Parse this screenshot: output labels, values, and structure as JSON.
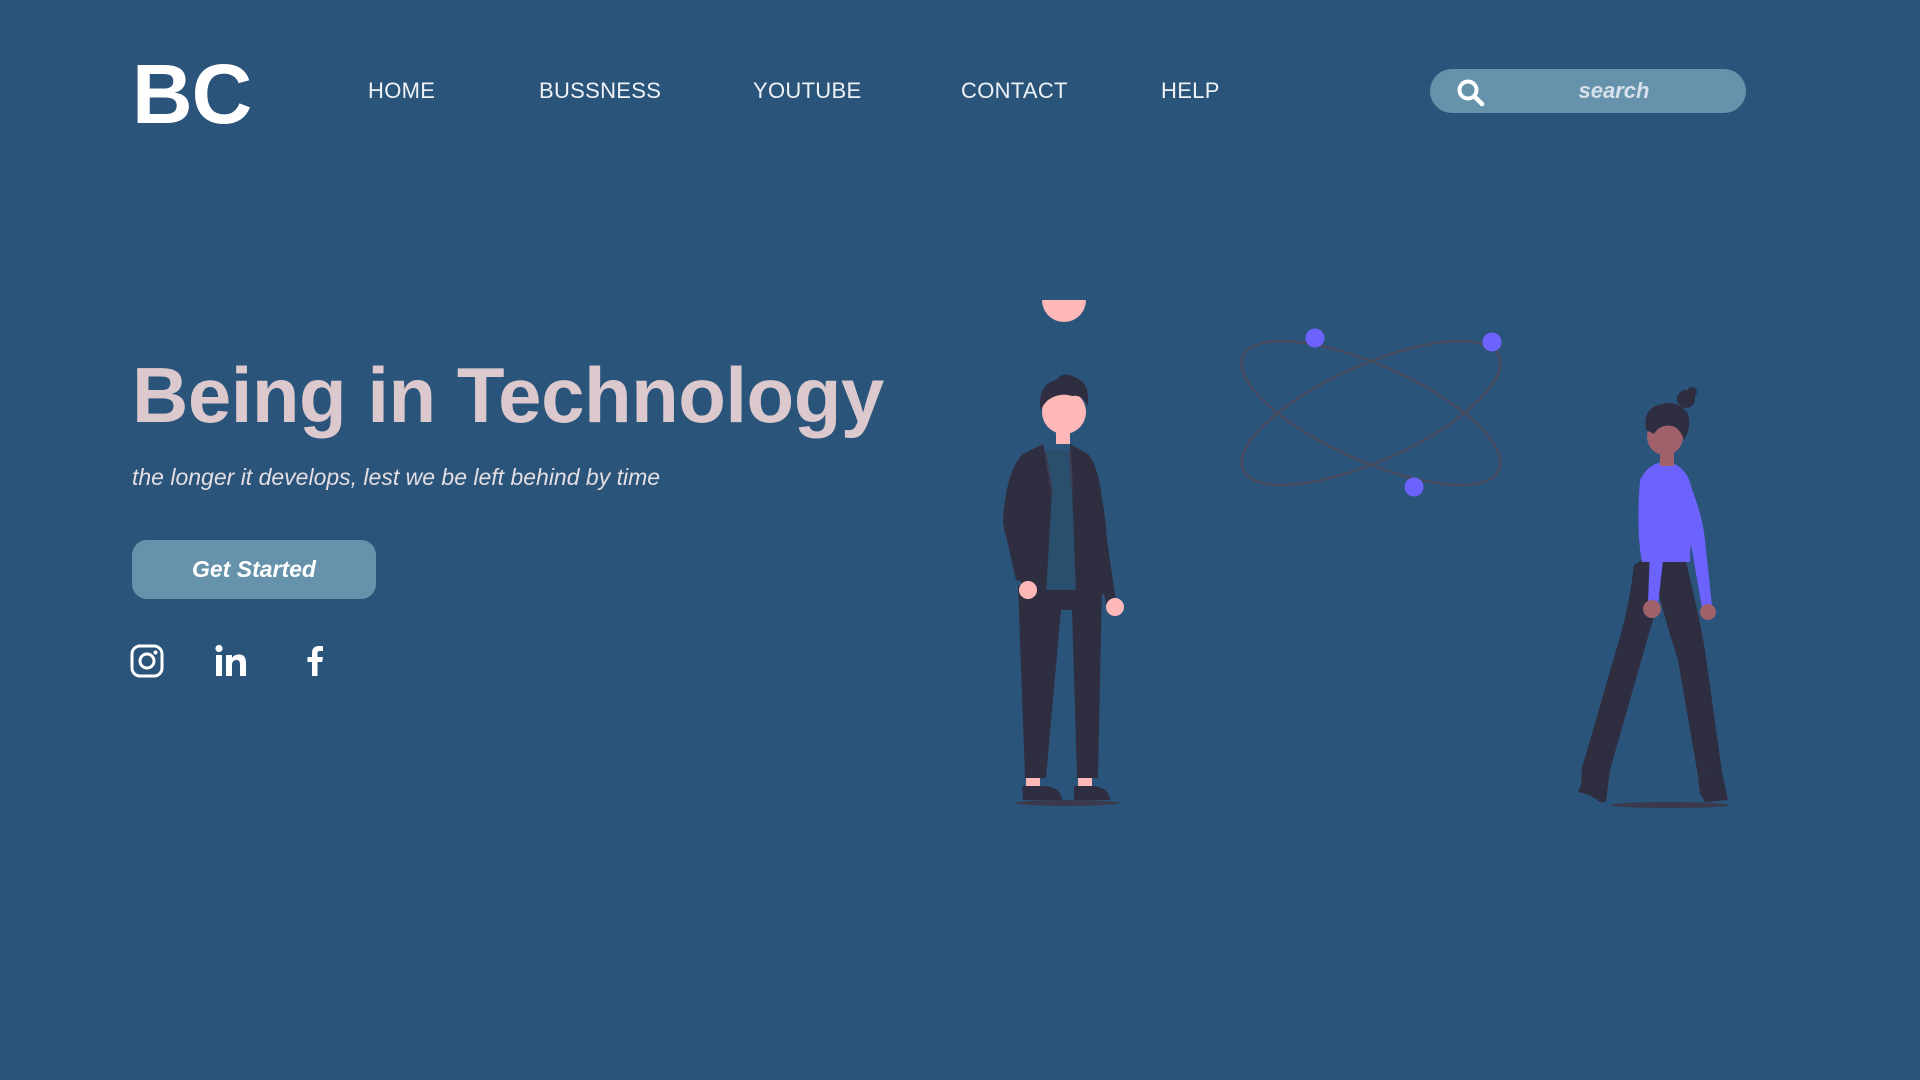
{
  "header": {
    "logo": "BC",
    "nav": [
      {
        "label": "HOME"
      },
      {
        "label": "BUSSNESS"
      },
      {
        "label": "YOUTUBE"
      },
      {
        "label": "CONTACT"
      },
      {
        "label": "HELP"
      }
    ],
    "search": {
      "placeholder": "search",
      "icon": "search-icon"
    }
  },
  "hero": {
    "title": "Being in Technology",
    "subtitle": "the longer it develops, lest we be left behind by time",
    "cta_label": "Get Started"
  },
  "social": [
    {
      "icon": "instagram-icon"
    },
    {
      "icon": "linkedin-icon"
    },
    {
      "icon": "facebook-icon"
    }
  ],
  "colors": {
    "background": "#2a547a",
    "accent": "#6692ac",
    "title": "#dcc9cd",
    "figure_dark": "#2f2e41",
    "figure_purple": "#6c63ff",
    "skin_light": "#ffb8b8",
    "skin_dark": "#a0616a"
  }
}
